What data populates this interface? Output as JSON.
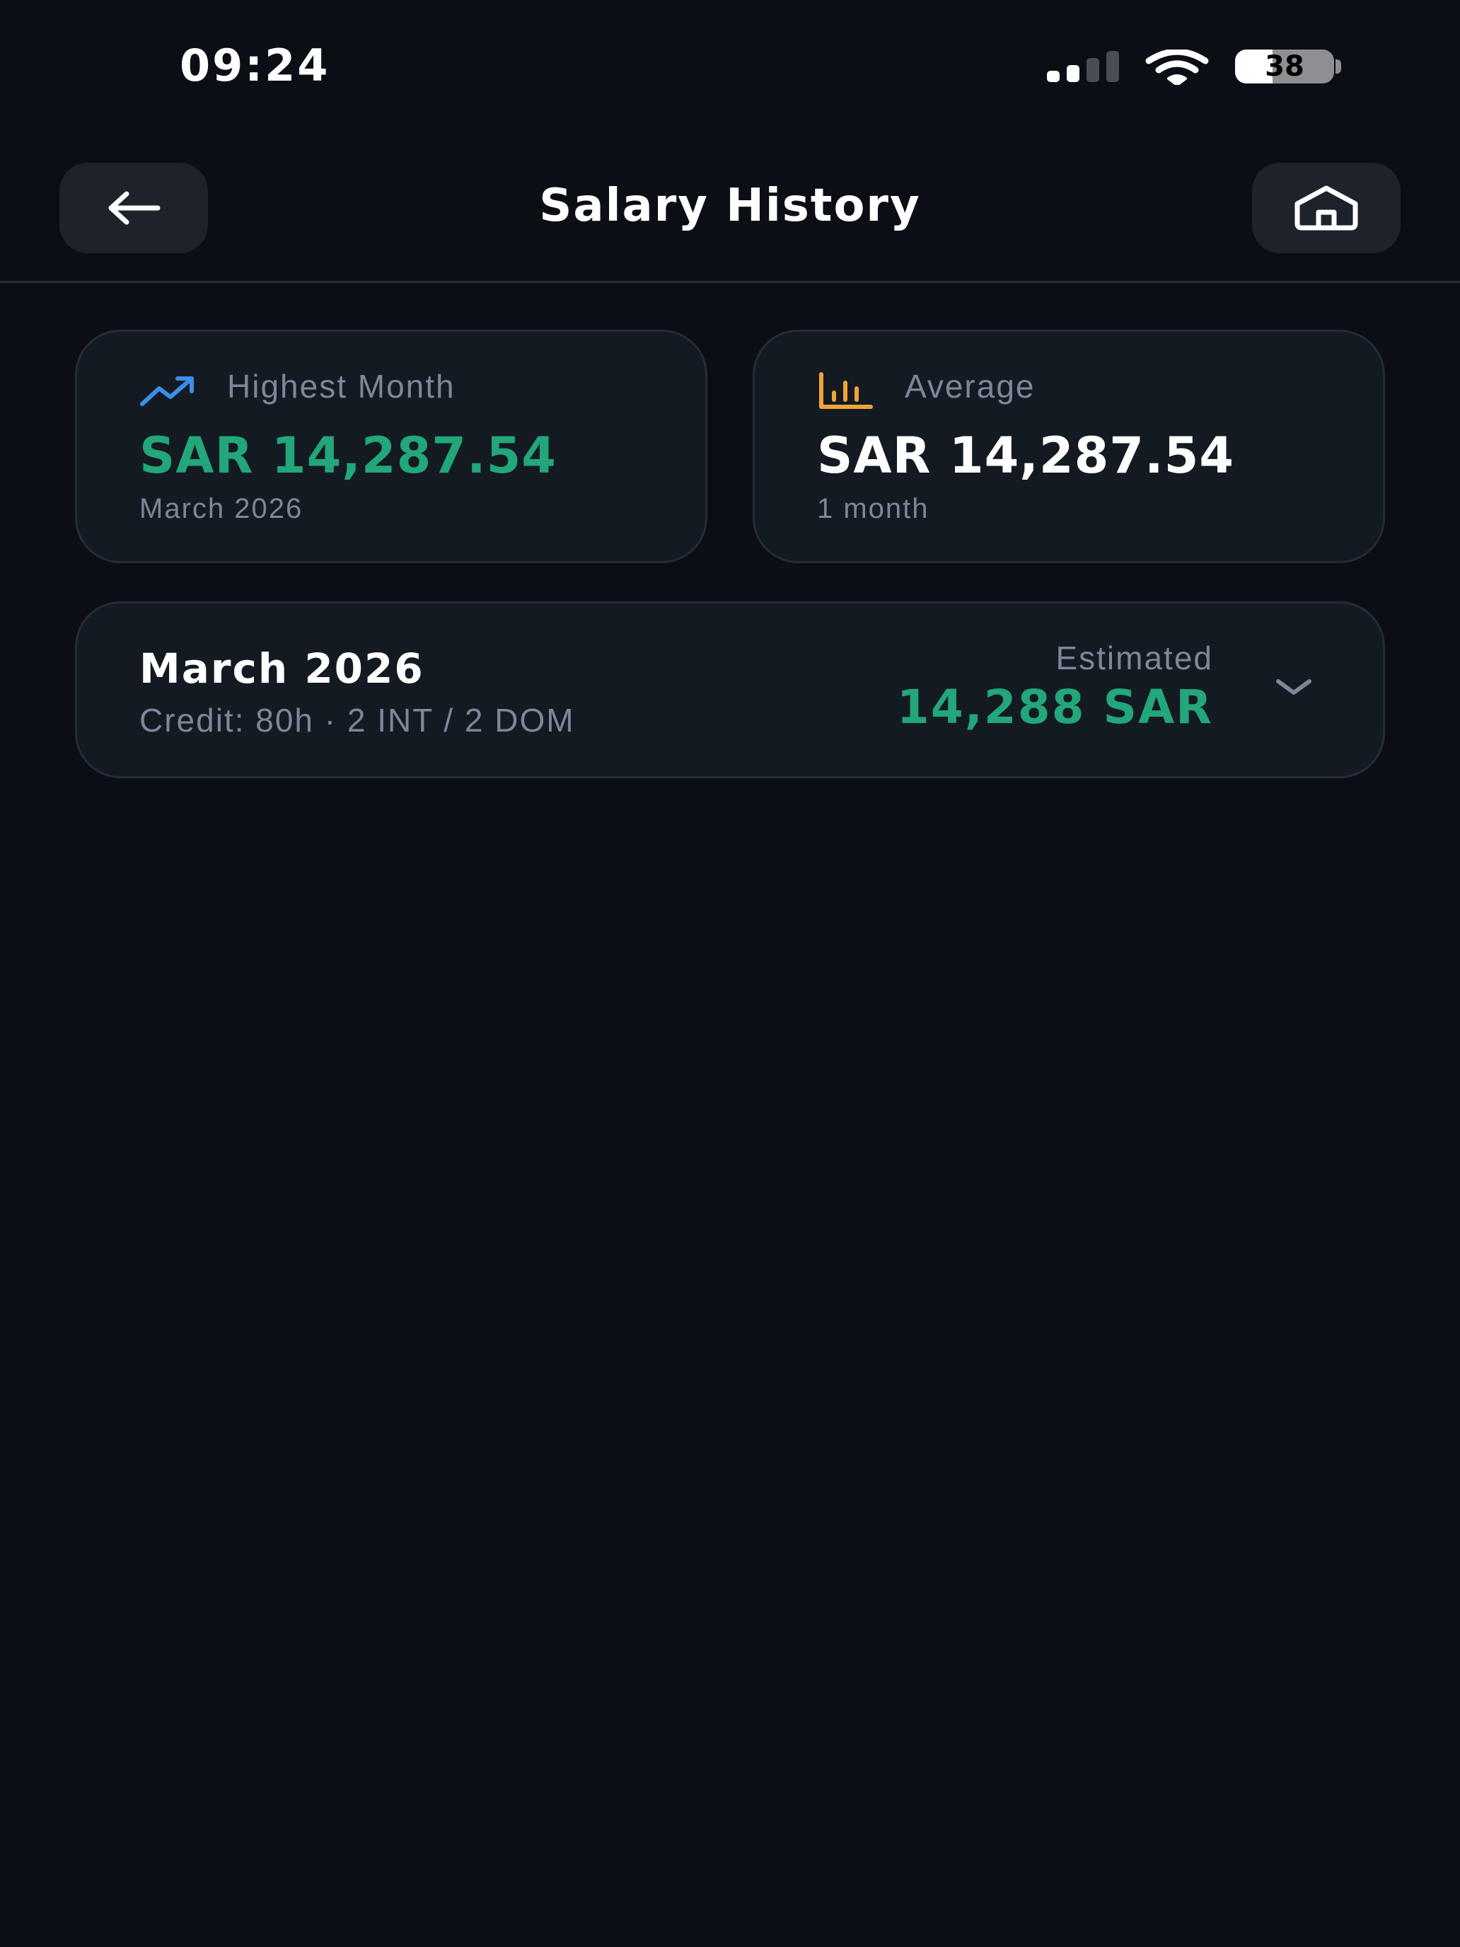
{
  "status_bar": {
    "time": "09:24",
    "battery_level": "38",
    "signal_bars_active": 2,
    "signal_bars_total": 4,
    "icons": [
      "signal-icon",
      "wifi-icon",
      "battery-icon"
    ]
  },
  "header": {
    "title": "Salary History",
    "back_icon": "arrow-left-icon",
    "home_icon": "home-icon"
  },
  "stats": {
    "highest": {
      "label": "Highest Month",
      "value": "SAR 14,287.54",
      "sub": "March 2026",
      "icon": "trending-up-icon"
    },
    "average": {
      "label": "Average",
      "value": "SAR 14,287.54",
      "sub": "1 month",
      "icon": "bar-chart-icon"
    }
  },
  "months": [
    {
      "title": "March 2026",
      "credit": "Credit: 80h · 2 INT / 2 DOM",
      "status": "Estimated",
      "amount": "14,288 SAR",
      "icon": "chevron-down-icon"
    }
  ],
  "colors": {
    "background": "#0b0e15",
    "card": "#141a22",
    "accent_green": "#22a67a",
    "accent_blue": "#3b8eea",
    "accent_orange": "#f0a43a",
    "muted_text": "#7d879b"
  }
}
